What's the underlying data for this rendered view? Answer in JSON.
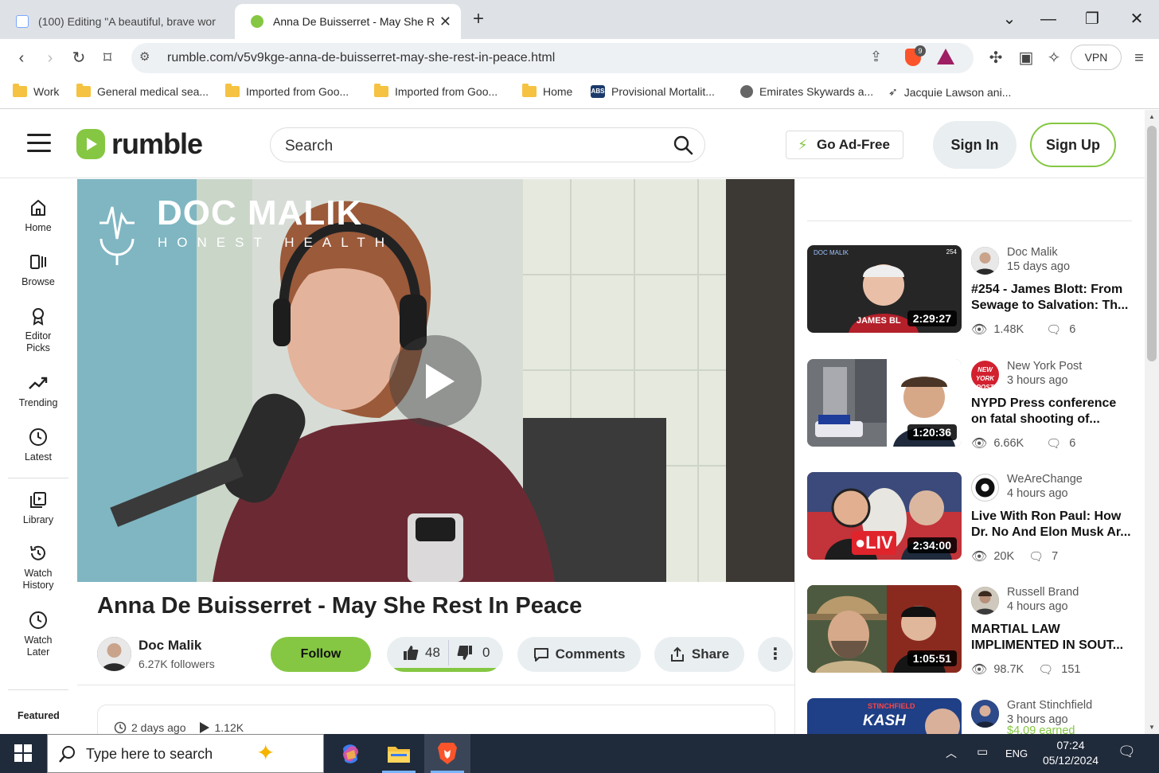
{
  "browser": {
    "tabs": [
      {
        "title": "(100) Editing \"A beautiful, brave wor"
      },
      {
        "title": "Anna De Buisserret - May She R"
      }
    ],
    "url": "rumble.com/v5v9kge-anna-de-buisserret-may-she-rest-in-peace.html",
    "vpn_label": "VPN",
    "shield_badge": "9",
    "bookmarks": [
      {
        "label": "Work",
        "icon": "folder-icon"
      },
      {
        "label": "General medical sea...",
        "icon": "folder-icon"
      },
      {
        "label": "Imported from Goo...",
        "icon": "folder-icon"
      },
      {
        "label": "Imported from Goo...",
        "icon": "folder-icon"
      },
      {
        "label": "Home",
        "icon": "folder-icon"
      },
      {
        "label": "Provisional Mortalit...",
        "icon": "abs-icon"
      },
      {
        "label": "Emirates Skywards a...",
        "icon": "globe-icon"
      },
      {
        "label": "Jacquie Lawson ani...",
        "icon": "bird-icon"
      }
    ]
  },
  "header": {
    "logo": "rumble",
    "search_placeholder": "Search",
    "go_ad_free": "Go Ad-Free",
    "sign_in": "Sign In",
    "sign_up": "Sign Up"
  },
  "sidebar": {
    "items": [
      {
        "label": "Home",
        "icon": "home-icon"
      },
      {
        "label": "Browse",
        "icon": "browse-icon"
      },
      {
        "label": "Editor Picks",
        "icon": "award-icon"
      },
      {
        "label": "Trending",
        "icon": "trending-icon"
      },
      {
        "label": "Latest",
        "icon": "clock-icon"
      },
      {
        "label": "Library",
        "icon": "library-icon"
      },
      {
        "label": "Watch History",
        "icon": "history-icon"
      },
      {
        "label": "Watch Later",
        "icon": "clock-icon"
      }
    ],
    "featured": "Featured"
  },
  "video": {
    "brand_line1": "DOC MALIK",
    "brand_line2": "HONEST HEALTH",
    "title": "Anna De Buisserret - May She Rest In Peace",
    "channel": "Doc Malik",
    "followers": "6.27K followers",
    "follow": "Follow",
    "likes": "48",
    "dislikes": "0",
    "comments": "Comments",
    "share": "Share",
    "posted": "2 days ago",
    "views": "1.12K"
  },
  "recommendations": [
    {
      "channel": "Doc Malik",
      "ago": "15 days ago",
      "title": "#254 - James Blott: From Sewage to Salvation: Th...",
      "views": "1.48K",
      "comments": "6",
      "duration": "2:29:27",
      "thumb_text": "JAMES BL",
      "badge": "254"
    },
    {
      "channel": "New York Post",
      "ago": "3 hours ago",
      "title": "NYPD Press conference on fatal shooting of...",
      "views": "6.66K",
      "comments": "6",
      "duration": "1:20:36"
    },
    {
      "channel": "WeAreChange",
      "ago": "4 hours ago",
      "title": "Live With Ron Paul: How Dr. No And Elon Musk Ar...",
      "views": "20K",
      "comments": "7",
      "duration": "2:34:00",
      "thumb_text": "LIV"
    },
    {
      "channel": "Russell Brand",
      "ago": "4 hours ago",
      "title": "MARTIAL LAW IMPLIMENTED IN SOUT...",
      "views": "98.7K",
      "comments": "151",
      "duration": "1:05:51"
    },
    {
      "channel": "Grant Stinchfield",
      "ago": "3 hours ago",
      "earned": "$4.09 earned",
      "thumb_text": "KASH",
      "thumb_sub": "STINCHFIELD"
    }
  ],
  "taskbar": {
    "search_placeholder": "Type here to search",
    "lang": "ENG",
    "time": "07:24",
    "date": "05/12/2024"
  },
  "colors": {
    "accent": "#85c742",
    "taskbar": "#1f2a3a"
  }
}
